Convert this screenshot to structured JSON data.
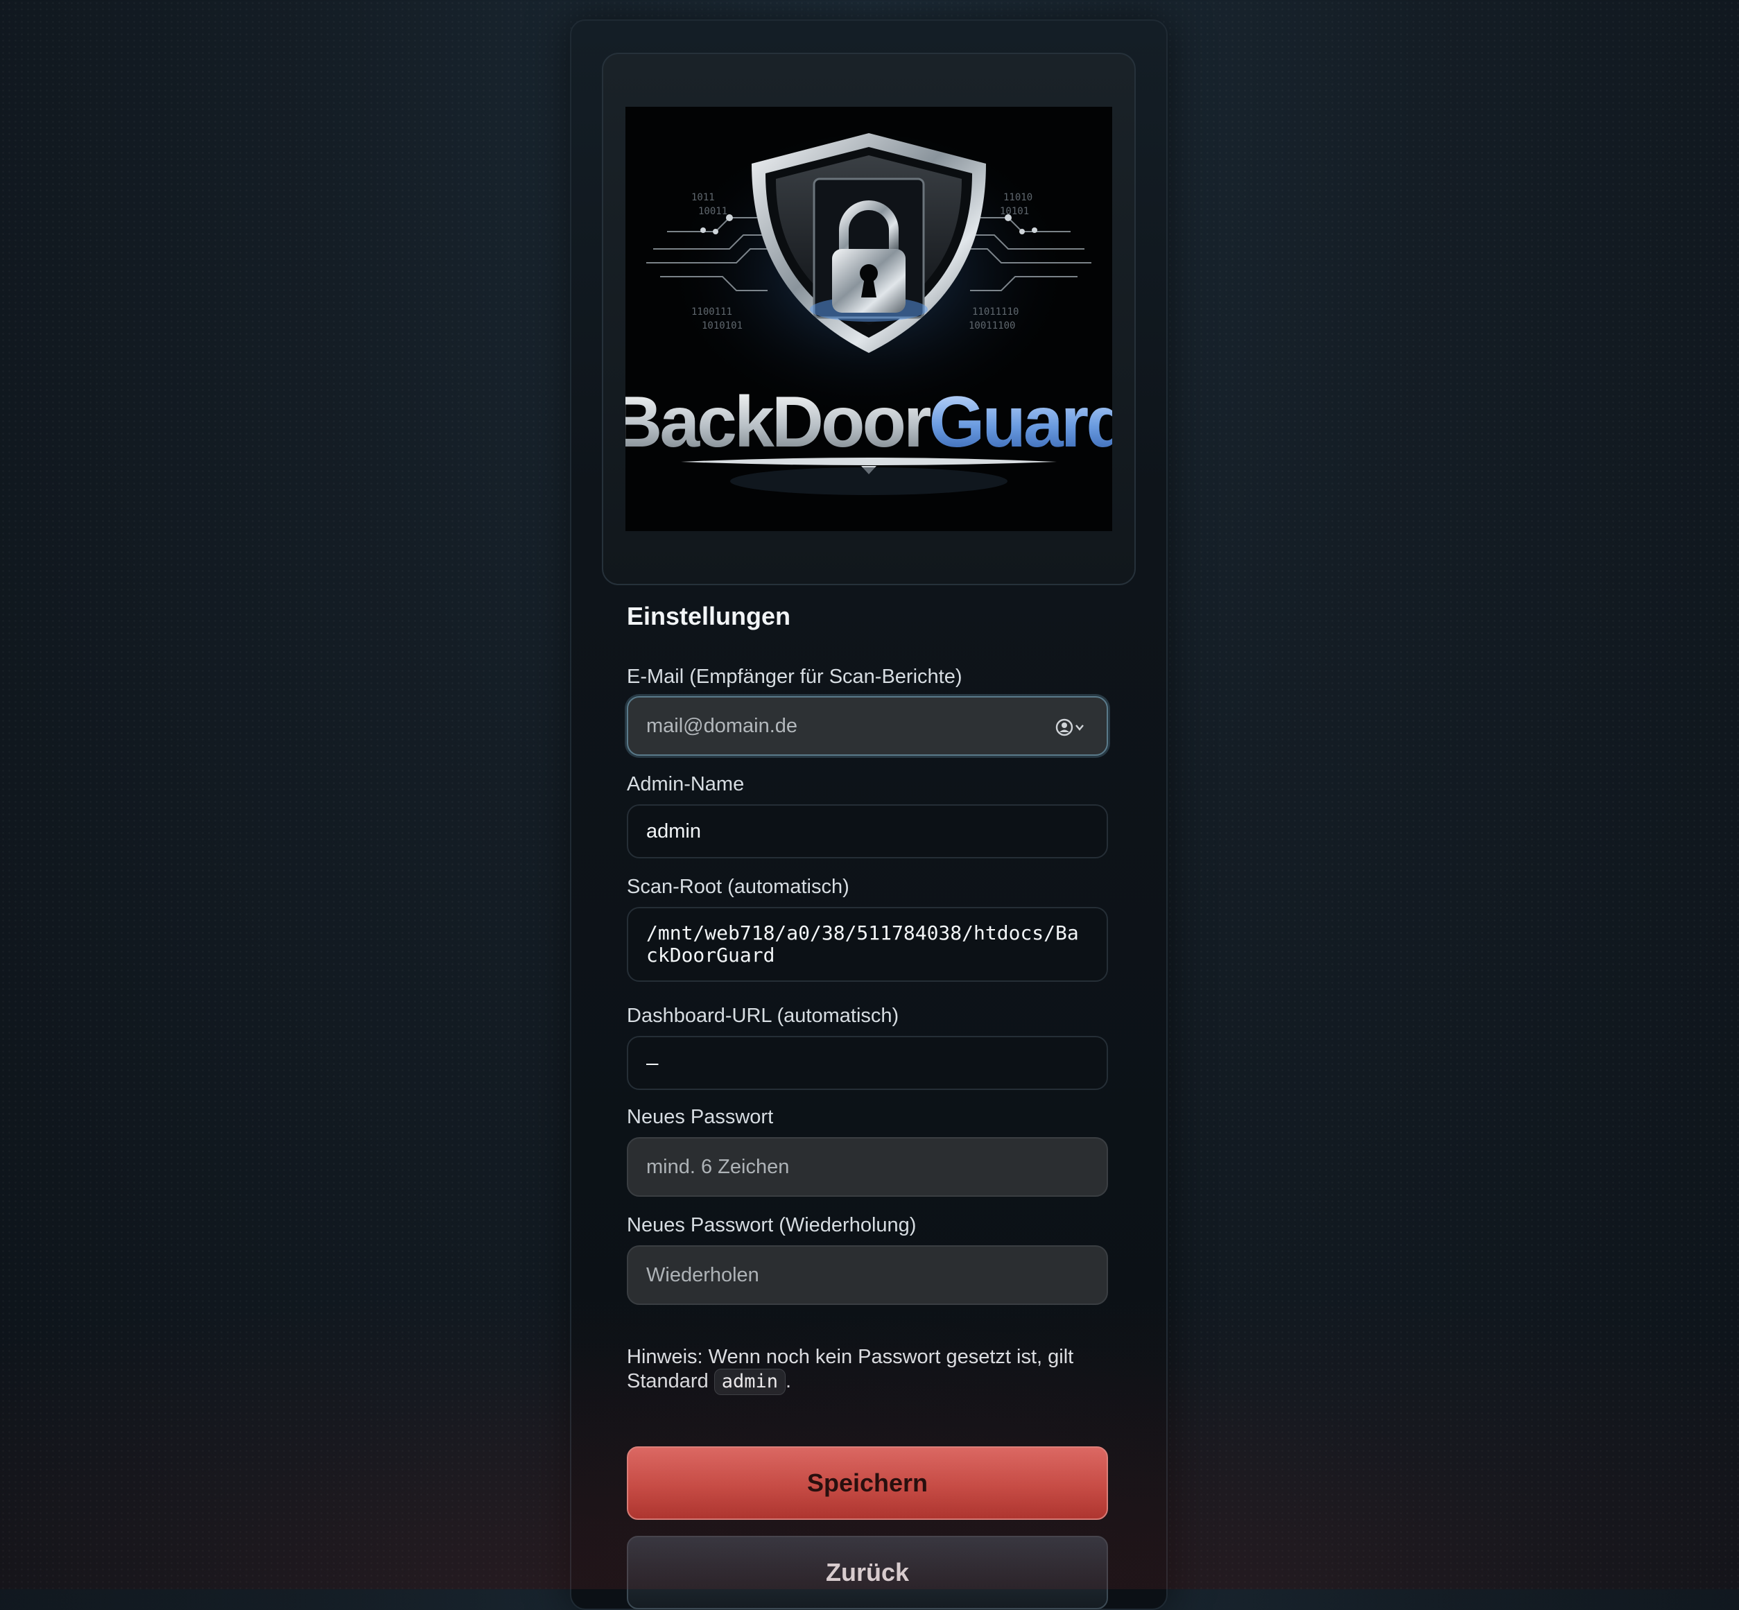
{
  "logo": {
    "brand_text": "BackDoorGuard"
  },
  "settings": {
    "title": "Einstellungen",
    "email": {
      "label": "E-Mail (Empfänger für Scan-Berichte)",
      "placeholder": "mail@domain.de",
      "value": ""
    },
    "admin_name": {
      "label": "Admin-Name",
      "value": "admin"
    },
    "scan_root": {
      "label": "Scan-Root (automatisch)",
      "value": "/mnt/web718/a0/38/511784038/htdocs/BackDoorGuard"
    },
    "dashboard_url": {
      "label": "Dashboard-URL (automatisch)",
      "value": "–"
    },
    "new_password": {
      "label": "Neues Passwort",
      "placeholder": "mind. 6 Zeichen"
    },
    "new_password_repeat": {
      "label": "Neues Passwort (Wiederholung)",
      "placeholder": "Wiederholen"
    },
    "hint": {
      "prefix": "Hinweis: Wenn noch kein Passwort gesetzt ist, gilt Standard",
      "code": "admin",
      "suffix": "."
    }
  },
  "buttons": {
    "save_label": "Speichern",
    "back_label": "Zurück"
  },
  "colors": {
    "accent_red": "#d4524a",
    "focus_ring": "#5a7a8a"
  }
}
